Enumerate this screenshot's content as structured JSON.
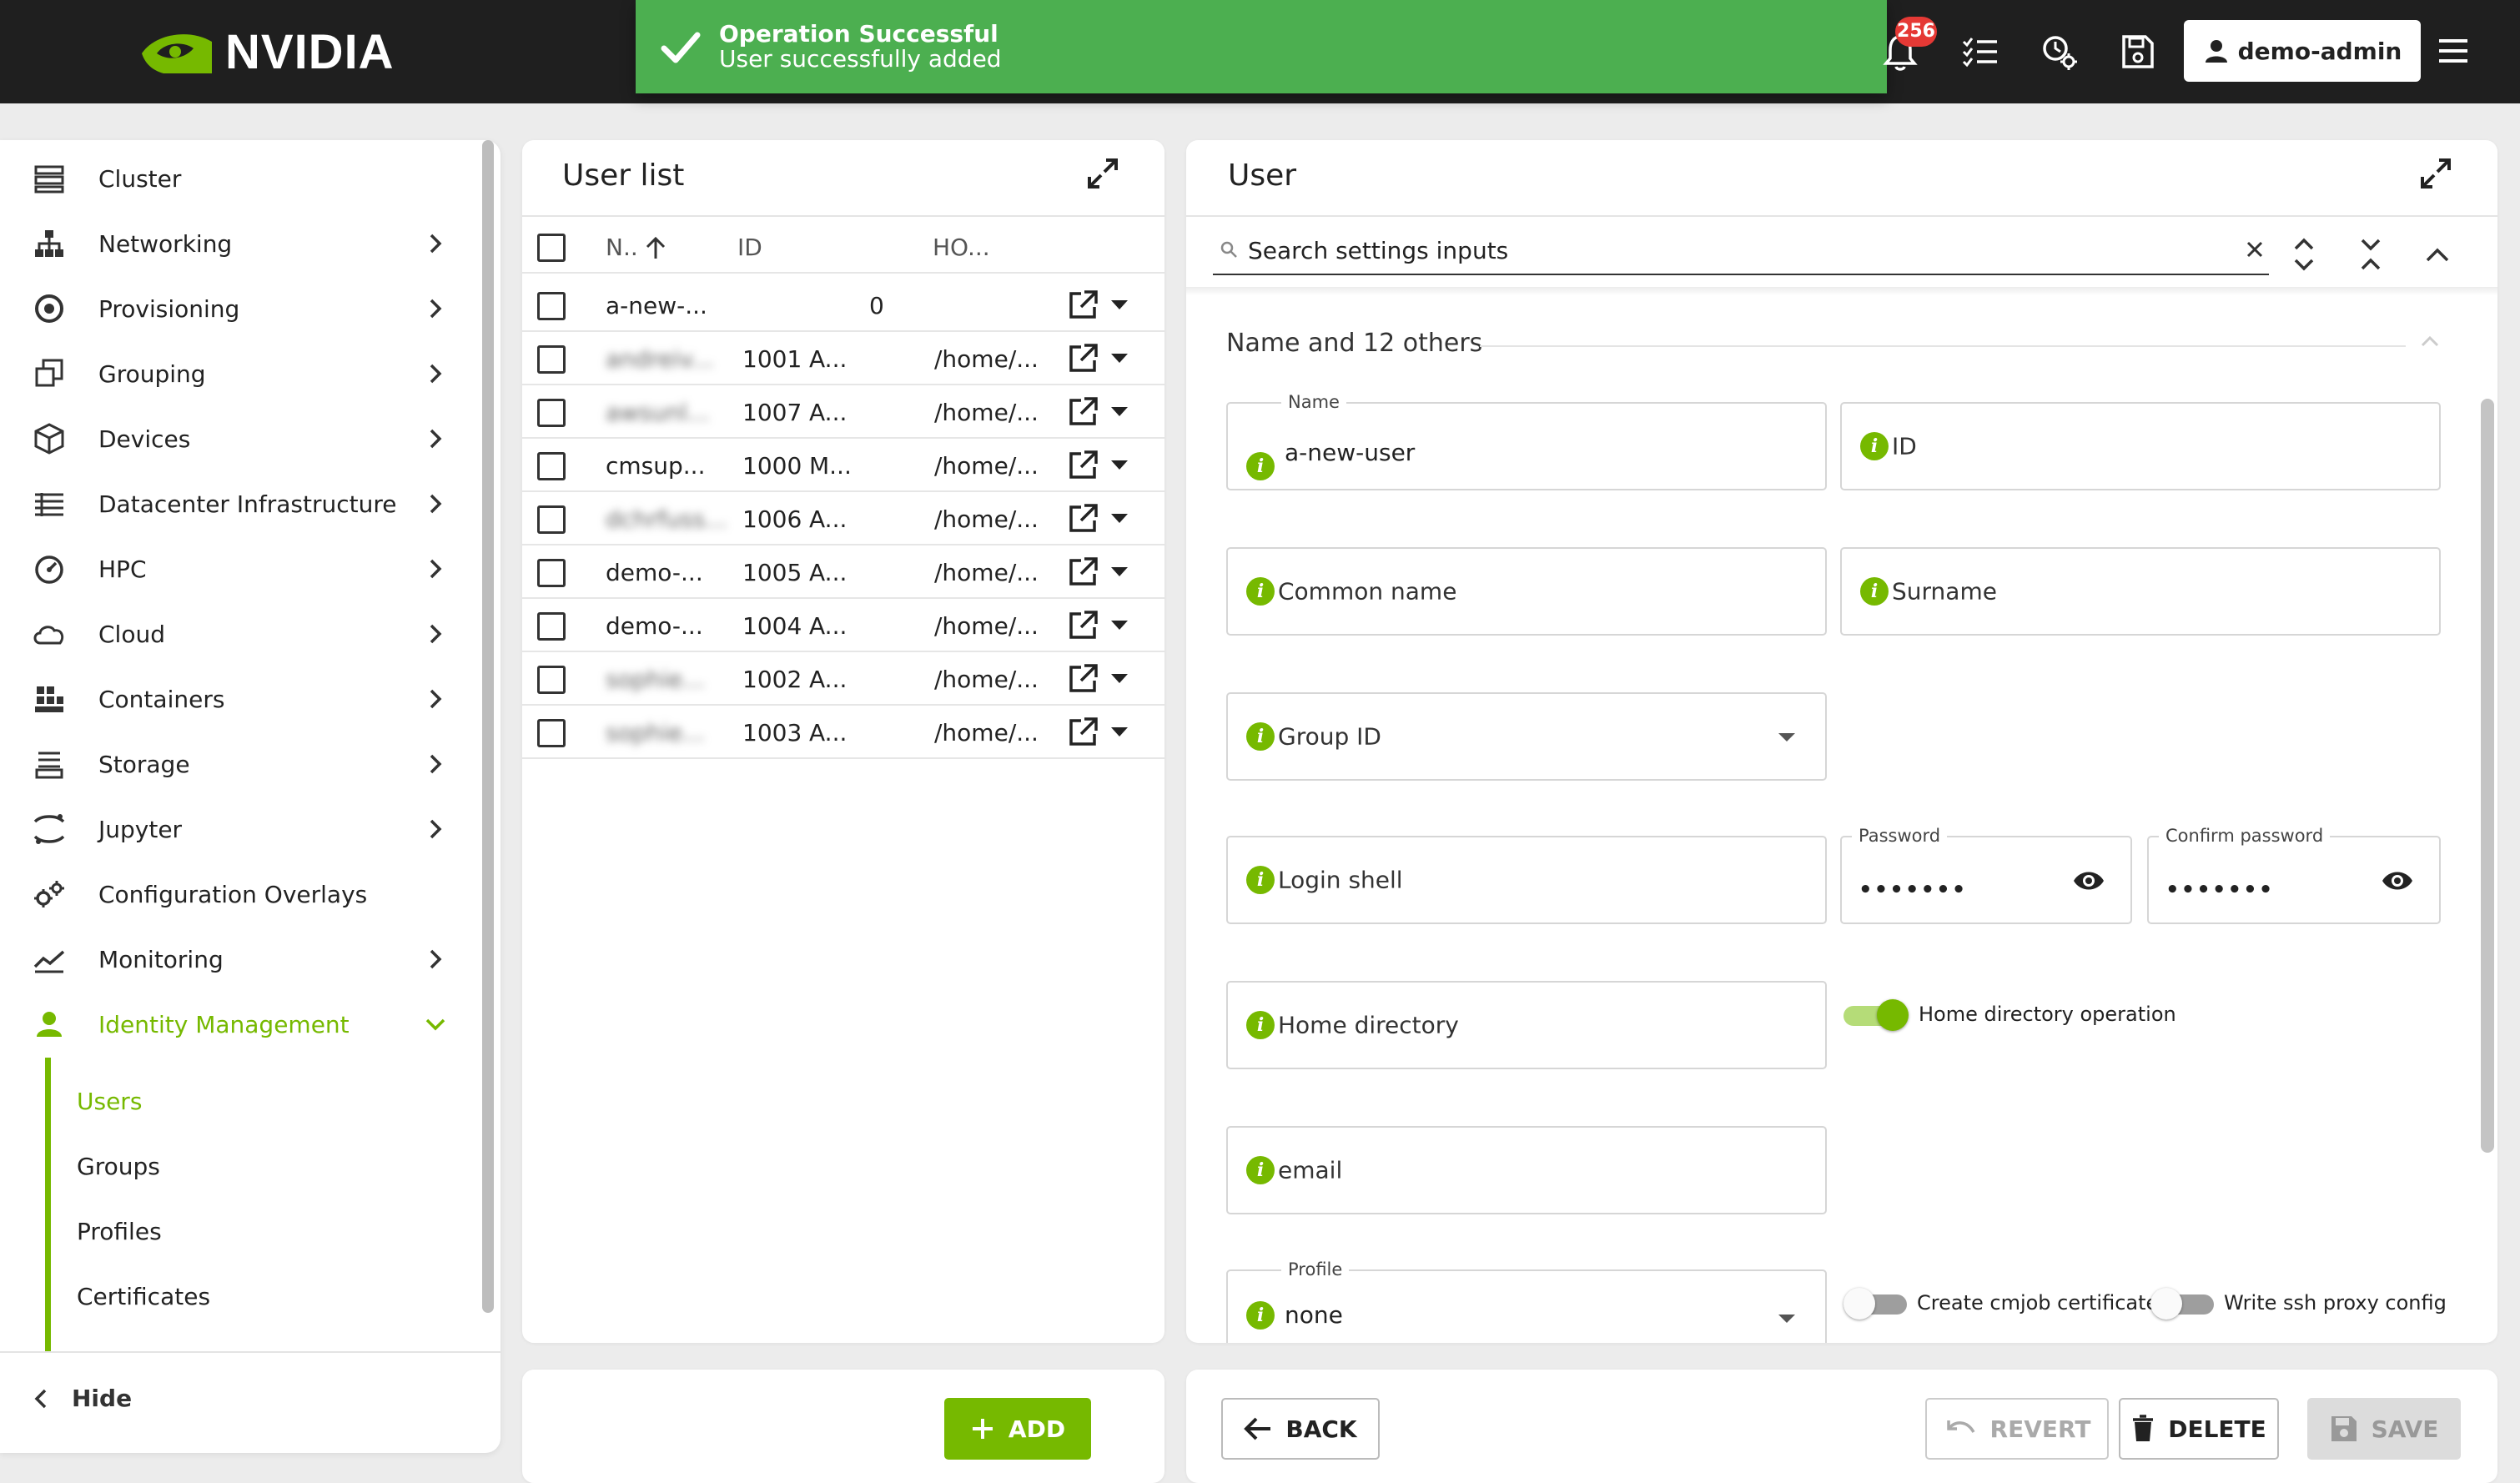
{
  "brand": {
    "name": "NVIDIA",
    "accent": "#76b900"
  },
  "toast": {
    "title": "Operation Successful",
    "message": "User successfully added",
    "color": "#4caf50"
  },
  "topbar": {
    "notifications_count": "256",
    "user_label": "demo-admin"
  },
  "sidebar": {
    "items": [
      {
        "label": "Cluster",
        "icon": "cluster-icon"
      },
      {
        "label": "Networking",
        "icon": "network-icon"
      },
      {
        "label": "Provisioning",
        "icon": "provisioning-icon"
      },
      {
        "label": "Grouping",
        "icon": "grouping-icon"
      },
      {
        "label": "Devices",
        "icon": "devices-icon"
      },
      {
        "label": "Datacenter Infrastructure",
        "icon": "datacenter-icon"
      },
      {
        "label": "HPC",
        "icon": "hpc-icon"
      },
      {
        "label": "Cloud",
        "icon": "cloud-icon"
      },
      {
        "label": "Containers",
        "icon": "containers-icon"
      },
      {
        "label": "Storage",
        "icon": "storage-icon"
      },
      {
        "label": "Jupyter",
        "icon": "jupyter-icon"
      },
      {
        "label": "Configuration Overlays",
        "icon": "config-overlays-icon"
      },
      {
        "label": "Monitoring",
        "icon": "monitoring-icon"
      },
      {
        "label": "Identity Management",
        "icon": "identity-icon"
      }
    ],
    "sub_items": [
      {
        "label": "Users"
      },
      {
        "label": "Groups"
      },
      {
        "label": "Profiles"
      },
      {
        "label": "Certificates"
      }
    ],
    "hide_label": "Hide"
  },
  "user_list": {
    "title": "User list",
    "columns": {
      "name": "N..",
      "id": "ID",
      "home": "HO..."
    },
    "rows": [
      {
        "name": "a-new-...",
        "id": "0",
        "group": "",
        "home": ""
      },
      {
        "name": "andreiv...",
        "id": "1001",
        "group": "A...",
        "home": "/home/..."
      },
      {
        "name": "awsunl...",
        "id": "1007",
        "group": "A...",
        "home": "/home/..."
      },
      {
        "name": "cmsup...",
        "id": "1000",
        "group": "M...",
        "home": "/home/..."
      },
      {
        "name": "dchrfuss...",
        "id": "1006",
        "group": "A...",
        "home": "/home/..."
      },
      {
        "name": "demo-...",
        "id": "1005",
        "group": "A...",
        "home": "/home/..."
      },
      {
        "name": "demo-...",
        "id": "1004",
        "group": "A...",
        "home": "/home/..."
      },
      {
        "name": "sophie...",
        "id": "1002",
        "group": "A...",
        "home": "/home/..."
      },
      {
        "name": "sophie...",
        "id": "1003",
        "group": "A...",
        "home": "/home/..."
      }
    ],
    "add_label": "ADD"
  },
  "user_panel": {
    "title": "User",
    "search_placeholder": "Search settings inputs",
    "section_title": "Name and 12 others",
    "fields": {
      "name_label": "Name",
      "name_value": "a-new-user",
      "id_label": "ID",
      "common_name_label": "Common name",
      "surname_label": "Surname",
      "group_id_label": "Group ID",
      "login_shell_label": "Login shell",
      "password_label": "Password",
      "password_value": "•••••••",
      "confirm_password_label": "Confirm password",
      "confirm_password_value": "•••••••",
      "home_directory_label": "Home directory",
      "home_dir_op_label": "Home directory operation",
      "email_label": "email",
      "profile_label": "Profile",
      "profile_value": "none",
      "cmjob_cert_label": "Create cmjob certificate",
      "ssh_proxy_label": "Write ssh proxy config"
    },
    "buttons": {
      "back": "BACK",
      "revert": "REVERT",
      "delete": "DELETE",
      "save": "SAVE"
    }
  }
}
